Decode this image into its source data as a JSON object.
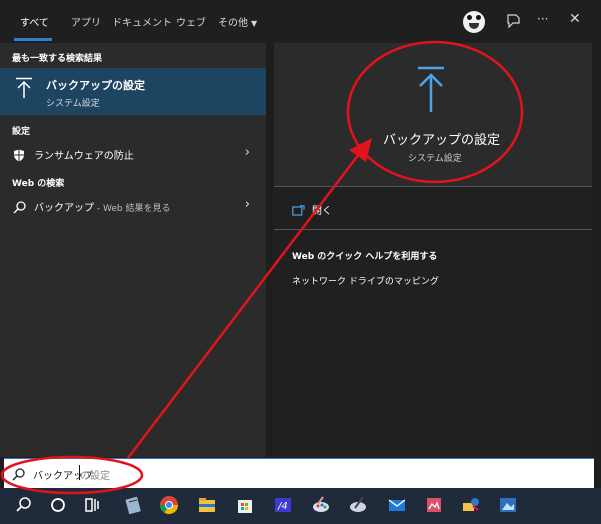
{
  "tabs": [
    {
      "label": "すべて"
    },
    {
      "label": "アプリ"
    },
    {
      "label": "ドキュメント"
    },
    {
      "label": "ウェブ"
    },
    {
      "label": "その他"
    }
  ],
  "top_icons": [
    "avatar",
    "feedback-icon",
    "more-icon",
    "close-icon"
  ],
  "more_glyph": "···",
  "close_glyph": "✕",
  "sections": {
    "best_match": "最も一致する検索結果",
    "settings": "設定",
    "web": "Web の検索"
  },
  "best_match": {
    "title": "バックアップの設定",
    "subtitle": "システム設定"
  },
  "settings_item": {
    "label": "ランサムウェアの防止",
    "arrow": "›"
  },
  "web_item": {
    "label": "バックアップ",
    "suffix": " - Web 結果を見る",
    "arrow": "›"
  },
  "detail": {
    "title": "バックアップの設定",
    "subtitle": "システム設定",
    "open_label": "開く",
    "web_help": "Web のクイック ヘルプを利用する",
    "web_link": "ネットワーク ドライブのマッピング"
  },
  "search": {
    "typed": "バックアップ",
    "ghost": "の設定"
  },
  "colors": {
    "accent": "#2d7fd1",
    "selected": "#1d4562",
    "annotation": "#e0141a"
  },
  "taskbar_icons": [
    "search-icon",
    "cortana-icon",
    "task-view-icon",
    "notepad-icon",
    "chrome-icon",
    "file-explorer-icon",
    "store-icon",
    "app-icon",
    "paint-icon",
    "pen-icon",
    "mail-icon",
    "photos-icon",
    "network-icon",
    "image-icon"
  ]
}
